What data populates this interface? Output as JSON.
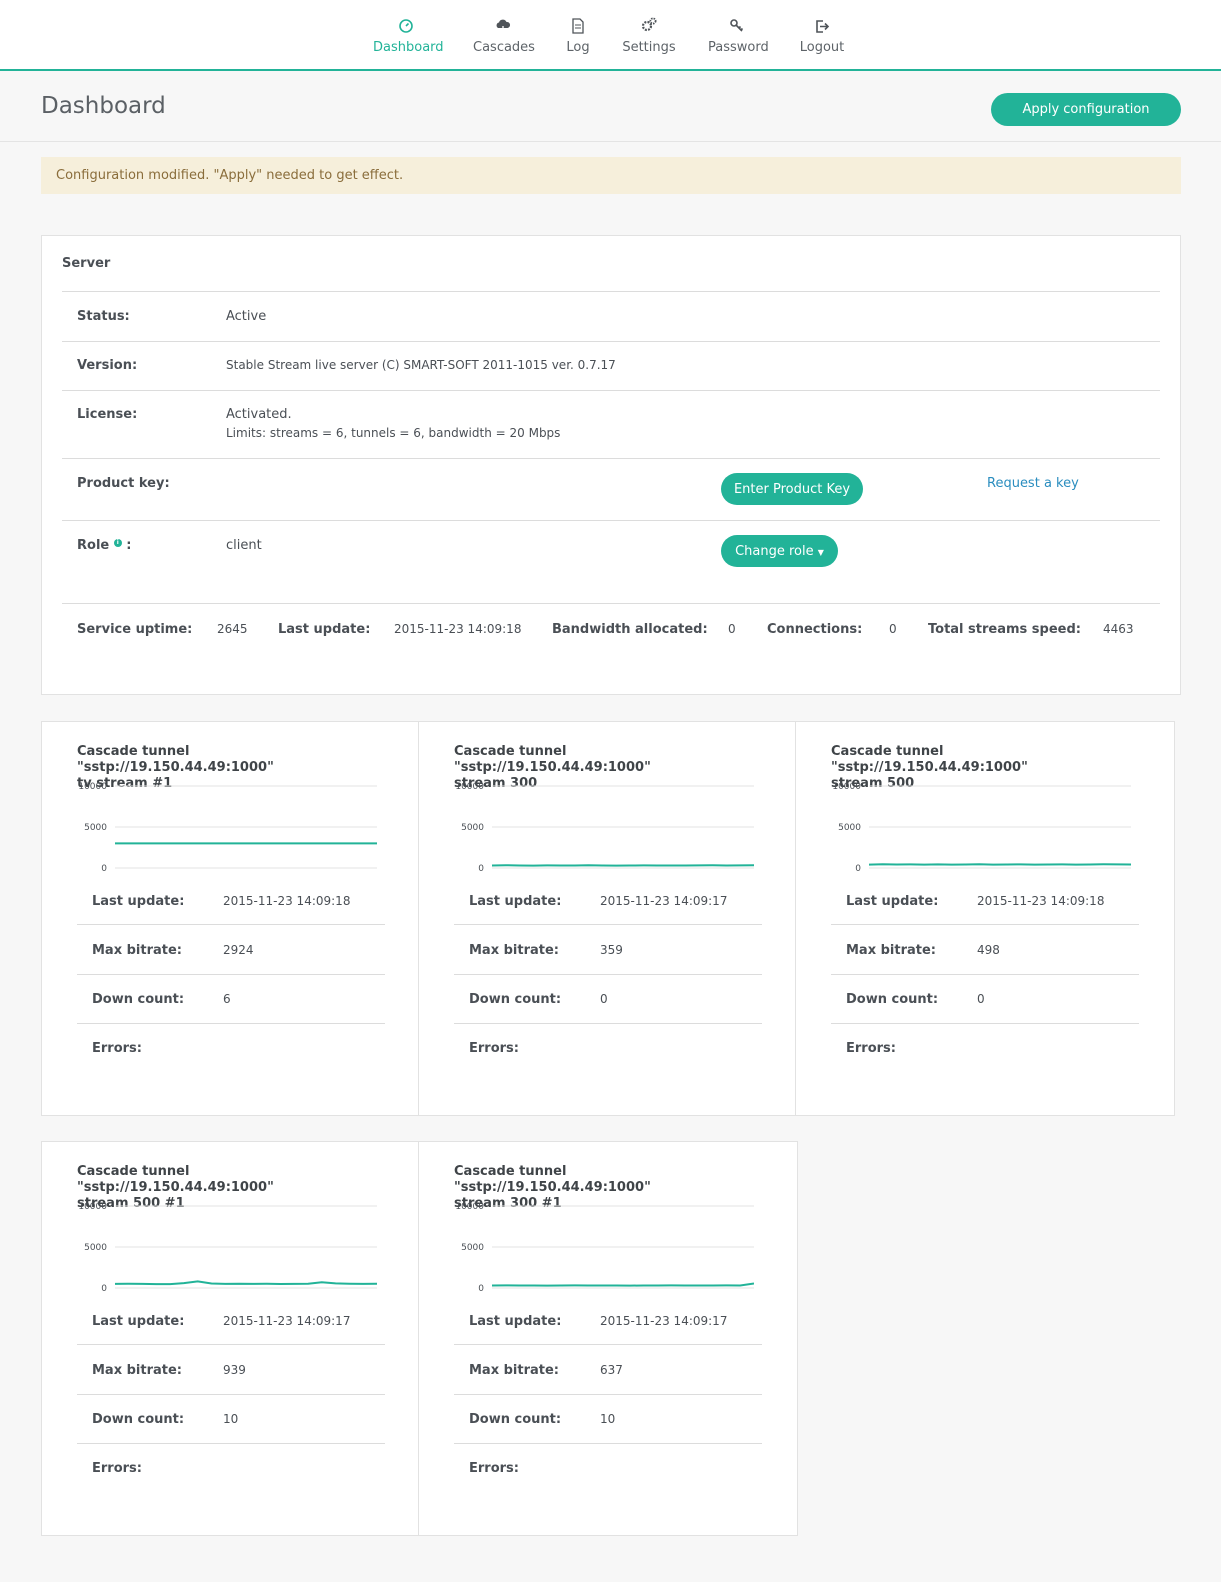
{
  "nav": {
    "items": [
      {
        "label": "Dashboard",
        "icon": "dashboard-icon"
      },
      {
        "label": "Cascades",
        "icon": "cloud-icon"
      },
      {
        "label": "Log",
        "icon": "document-icon"
      },
      {
        "label": "Settings",
        "icon": "gears-icon"
      },
      {
        "label": "Password",
        "icon": "key-icon"
      },
      {
        "label": "Logout",
        "icon": "logout-icon"
      }
    ],
    "active": "Dashboard"
  },
  "header": {
    "title": "Dashboard",
    "apply_label": "Apply configuration"
  },
  "alert": "Configuration modified. \"Apply\" needed to get effect.",
  "server": {
    "title": "Server",
    "status_label": "Status:",
    "status_value": "Active",
    "version_label": "Version:",
    "version_value": "Stable Stream live server (C) SMART-SOFT 2011-1015 ver. 0.7.17",
    "license_label": "License:",
    "license_line1": "Activated.",
    "license_line2": "Limits: streams = 6, tunnels = 6, bandwidth = 20 Mbps",
    "product_key_label": "Product key:",
    "enter_key_label": "Enter Product Key",
    "request_key_label": "Request a key",
    "role_label": "Role",
    "role_colon": ":",
    "role_value": "client",
    "change_role_label": "Change role",
    "stats": {
      "uptime_label": "Service uptime:",
      "uptime_value": "2645",
      "last_update_label": "Last update:",
      "last_update_value": "2015-11-23 14:09:18",
      "bandwidth_label": "Bandwidth allocated:",
      "bandwidth_value": "0",
      "connections_label": "Connections:",
      "connections_value": "0",
      "speed_label": "Total streams speed:",
      "speed_value": "4463"
    }
  },
  "card_labels": {
    "last_update": "Last update:",
    "max_bitrate": "Max bitrate:",
    "down_count": "Down count:",
    "errors": "Errors:"
  },
  "streams": [
    {
      "title_line1": "Cascade tunnel \"sstp://19.150.44.49:1000\"",
      "title_line2": "tv stream #1",
      "last_update": "2015-11-23 14:09:18",
      "max_bitrate": "2924",
      "down_count": "6",
      "errors": ""
    },
    {
      "title_line1": "Cascade tunnel \"sstp://19.150.44.49:1000\"",
      "title_line2": "stream 300",
      "last_update": "2015-11-23 14:09:17",
      "max_bitrate": "359",
      "down_count": "0",
      "errors": ""
    },
    {
      "title_line1": "Cascade tunnel \"sstp://19.150.44.49:1000\"",
      "title_line2": "stream 500",
      "last_update": "2015-11-23 14:09:18",
      "max_bitrate": "498",
      "down_count": "0",
      "errors": ""
    },
    {
      "title_line1": "Cascade tunnel \"sstp://19.150.44.49:1000\"",
      "title_line2": "stream 500 #1",
      "last_update": "2015-11-23 14:09:17",
      "max_bitrate": "939",
      "down_count": "10",
      "errors": ""
    },
    {
      "title_line1": "Cascade tunnel \"sstp://19.150.44.49:1000\"",
      "title_line2": "stream 300 #1",
      "last_update": "2015-11-23 14:09:17",
      "max_bitrate": "637",
      "down_count": "10",
      "errors": ""
    }
  ],
  "chart_data": [
    {
      "type": "line",
      "title": "",
      "ylim": [
        0,
        10000
      ],
      "yticks": [
        "10000",
        "5000",
        "0"
      ],
      "grid": true,
      "line_color": "#22b398",
      "series": [
        {
          "values": [
            3000,
            3000,
            3000,
            3000,
            3000,
            3000,
            3000,
            3000,
            3000,
            3000,
            3000,
            3000,
            3000,
            3000,
            3000,
            3000,
            3000,
            3000,
            3000,
            3000
          ]
        }
      ]
    },
    {
      "type": "line",
      "title": "",
      "ylim": [
        0,
        10000
      ],
      "yticks": [
        "10000",
        "5000",
        "0"
      ],
      "grid": true,
      "line_color": "#22b398",
      "series": [
        {
          "values": [
            300,
            340,
            310,
            290,
            320,
            300,
            310,
            330,
            300,
            290,
            310,
            320,
            300,
            310,
            300,
            320,
            330,
            310,
            320,
            340
          ]
        }
      ]
    },
    {
      "type": "line",
      "title": "",
      "ylim": [
        0,
        10000
      ],
      "yticks": [
        "10000",
        "5000",
        "0"
      ],
      "grid": true,
      "line_color": "#22b398",
      "series": [
        {
          "values": [
            420,
            450,
            430,
            440,
            410,
            440,
            420,
            430,
            450,
            420,
            430,
            440,
            420,
            430,
            440,
            420,
            430,
            450,
            440,
            430
          ]
        }
      ]
    },
    {
      "type": "line",
      "title": "",
      "ylim": [
        0,
        10000
      ],
      "yticks": [
        "10000",
        "5000",
        "0"
      ],
      "grid": true,
      "line_color": "#22b398",
      "series": [
        {
          "values": [
            500,
            520,
            500,
            480,
            470,
            600,
            800,
            550,
            500,
            520,
            500,
            510,
            490,
            500,
            520,
            700,
            560,
            520,
            500,
            510
          ]
        }
      ]
    },
    {
      "type": "line",
      "title": "",
      "ylim": [
        0,
        10000
      ],
      "yticks": [
        "10000",
        "5000",
        "0"
      ],
      "grid": true,
      "line_color": "#22b398",
      "series": [
        {
          "values": [
            300,
            320,
            300,
            310,
            290,
            300,
            320,
            300,
            310,
            300,
            290,
            310,
            300,
            320,
            300,
            310,
            300,
            320,
            310,
            550
          ]
        }
      ]
    }
  ]
}
